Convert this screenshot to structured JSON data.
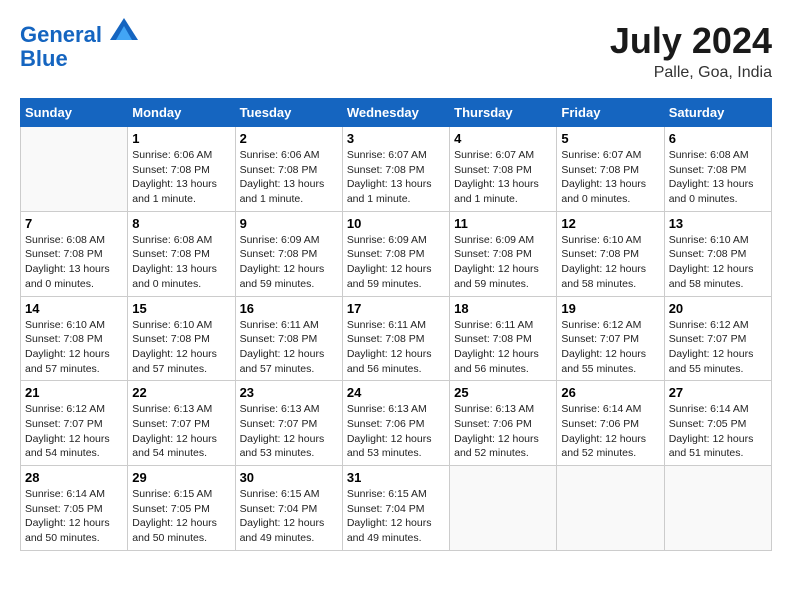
{
  "logo": {
    "line1": "General",
    "line2": "Blue"
  },
  "title": "July 2024",
  "subtitle": "Palle, Goa, India",
  "days_of_week": [
    "Sunday",
    "Monday",
    "Tuesday",
    "Wednesday",
    "Thursday",
    "Friday",
    "Saturday"
  ],
  "weeks": [
    [
      {
        "num": "",
        "info": ""
      },
      {
        "num": "1",
        "info": "Sunrise: 6:06 AM\nSunset: 7:08 PM\nDaylight: 13 hours\nand 1 minute."
      },
      {
        "num": "2",
        "info": "Sunrise: 6:06 AM\nSunset: 7:08 PM\nDaylight: 13 hours\nand 1 minute."
      },
      {
        "num": "3",
        "info": "Sunrise: 6:07 AM\nSunset: 7:08 PM\nDaylight: 13 hours\nand 1 minute."
      },
      {
        "num": "4",
        "info": "Sunrise: 6:07 AM\nSunset: 7:08 PM\nDaylight: 13 hours\nand 1 minute."
      },
      {
        "num": "5",
        "info": "Sunrise: 6:07 AM\nSunset: 7:08 PM\nDaylight: 13 hours\nand 0 minutes."
      },
      {
        "num": "6",
        "info": "Sunrise: 6:08 AM\nSunset: 7:08 PM\nDaylight: 13 hours\nand 0 minutes."
      }
    ],
    [
      {
        "num": "7",
        "info": "Sunrise: 6:08 AM\nSunset: 7:08 PM\nDaylight: 13 hours\nand 0 minutes."
      },
      {
        "num": "8",
        "info": "Sunrise: 6:08 AM\nSunset: 7:08 PM\nDaylight: 13 hours\nand 0 minutes."
      },
      {
        "num": "9",
        "info": "Sunrise: 6:09 AM\nSunset: 7:08 PM\nDaylight: 12 hours\nand 59 minutes."
      },
      {
        "num": "10",
        "info": "Sunrise: 6:09 AM\nSunset: 7:08 PM\nDaylight: 12 hours\nand 59 minutes."
      },
      {
        "num": "11",
        "info": "Sunrise: 6:09 AM\nSunset: 7:08 PM\nDaylight: 12 hours\nand 59 minutes."
      },
      {
        "num": "12",
        "info": "Sunrise: 6:10 AM\nSunset: 7:08 PM\nDaylight: 12 hours\nand 58 minutes."
      },
      {
        "num": "13",
        "info": "Sunrise: 6:10 AM\nSunset: 7:08 PM\nDaylight: 12 hours\nand 58 minutes."
      }
    ],
    [
      {
        "num": "14",
        "info": "Sunrise: 6:10 AM\nSunset: 7:08 PM\nDaylight: 12 hours\nand 57 minutes."
      },
      {
        "num": "15",
        "info": "Sunrise: 6:10 AM\nSunset: 7:08 PM\nDaylight: 12 hours\nand 57 minutes."
      },
      {
        "num": "16",
        "info": "Sunrise: 6:11 AM\nSunset: 7:08 PM\nDaylight: 12 hours\nand 57 minutes."
      },
      {
        "num": "17",
        "info": "Sunrise: 6:11 AM\nSunset: 7:08 PM\nDaylight: 12 hours\nand 56 minutes."
      },
      {
        "num": "18",
        "info": "Sunrise: 6:11 AM\nSunset: 7:08 PM\nDaylight: 12 hours\nand 56 minutes."
      },
      {
        "num": "19",
        "info": "Sunrise: 6:12 AM\nSunset: 7:07 PM\nDaylight: 12 hours\nand 55 minutes."
      },
      {
        "num": "20",
        "info": "Sunrise: 6:12 AM\nSunset: 7:07 PM\nDaylight: 12 hours\nand 55 minutes."
      }
    ],
    [
      {
        "num": "21",
        "info": "Sunrise: 6:12 AM\nSunset: 7:07 PM\nDaylight: 12 hours\nand 54 minutes."
      },
      {
        "num": "22",
        "info": "Sunrise: 6:13 AM\nSunset: 7:07 PM\nDaylight: 12 hours\nand 54 minutes."
      },
      {
        "num": "23",
        "info": "Sunrise: 6:13 AM\nSunset: 7:07 PM\nDaylight: 12 hours\nand 53 minutes."
      },
      {
        "num": "24",
        "info": "Sunrise: 6:13 AM\nSunset: 7:06 PM\nDaylight: 12 hours\nand 53 minutes."
      },
      {
        "num": "25",
        "info": "Sunrise: 6:13 AM\nSunset: 7:06 PM\nDaylight: 12 hours\nand 52 minutes."
      },
      {
        "num": "26",
        "info": "Sunrise: 6:14 AM\nSunset: 7:06 PM\nDaylight: 12 hours\nand 52 minutes."
      },
      {
        "num": "27",
        "info": "Sunrise: 6:14 AM\nSunset: 7:05 PM\nDaylight: 12 hours\nand 51 minutes."
      }
    ],
    [
      {
        "num": "28",
        "info": "Sunrise: 6:14 AM\nSunset: 7:05 PM\nDaylight: 12 hours\nand 50 minutes."
      },
      {
        "num": "29",
        "info": "Sunrise: 6:15 AM\nSunset: 7:05 PM\nDaylight: 12 hours\nand 50 minutes."
      },
      {
        "num": "30",
        "info": "Sunrise: 6:15 AM\nSunset: 7:04 PM\nDaylight: 12 hours\nand 49 minutes."
      },
      {
        "num": "31",
        "info": "Sunrise: 6:15 AM\nSunset: 7:04 PM\nDaylight: 12 hours\nand 49 minutes."
      },
      {
        "num": "",
        "info": ""
      },
      {
        "num": "",
        "info": ""
      },
      {
        "num": "",
        "info": ""
      }
    ]
  ]
}
